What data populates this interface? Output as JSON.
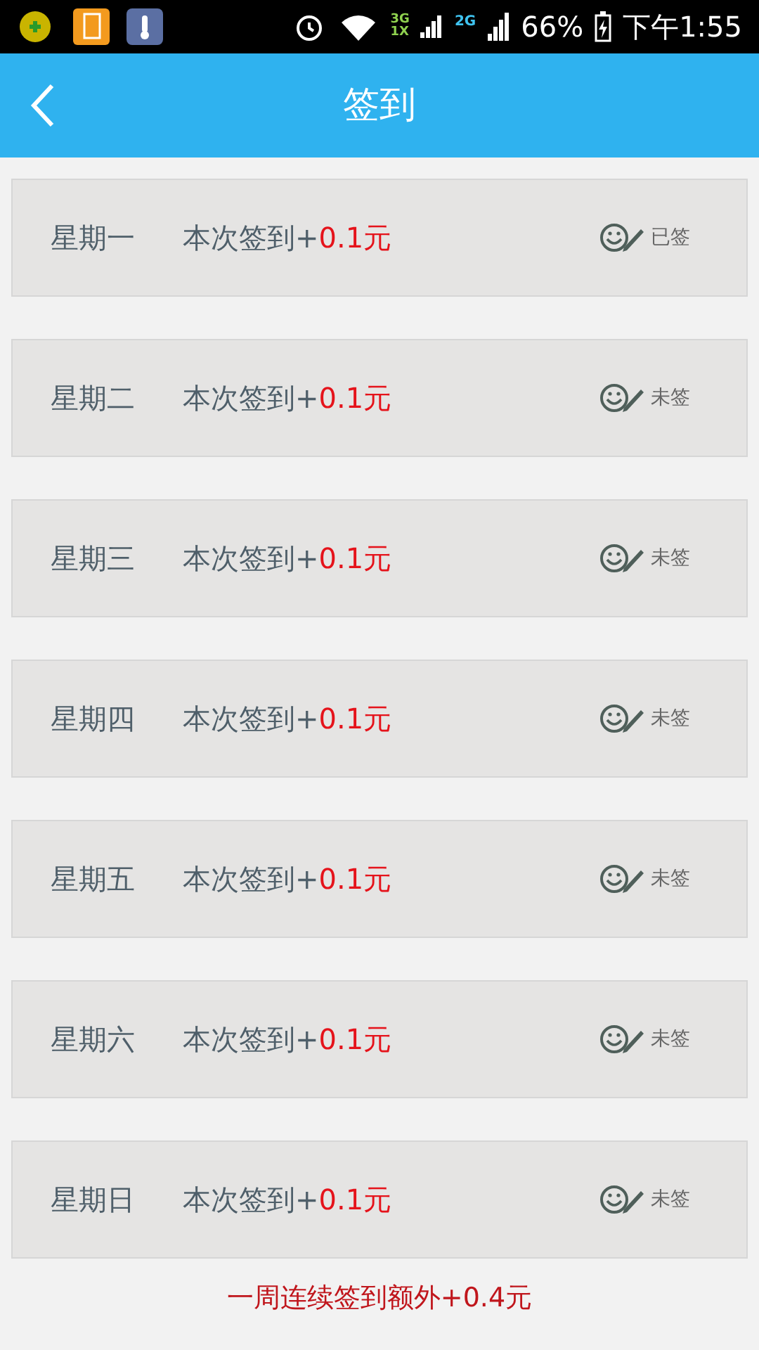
{
  "status_bar": {
    "network_3g": "3G",
    "network_1x": "1X",
    "network_2g": "2G",
    "battery": "66%",
    "time": "下午1:55"
  },
  "header": {
    "title": "签到"
  },
  "days": [
    {
      "day": "星期一",
      "reward_label": "本次签到+",
      "amount": "0.1元",
      "status": "已签"
    },
    {
      "day": "星期二",
      "reward_label": "本次签到+",
      "amount": "0.1元",
      "status": "未签"
    },
    {
      "day": "星期三",
      "reward_label": "本次签到+",
      "amount": "0.1元",
      "status": "未签"
    },
    {
      "day": "星期四",
      "reward_label": "本次签到+",
      "amount": "0.1元",
      "status": "未签"
    },
    {
      "day": "星期五",
      "reward_label": "本次签到+",
      "amount": "0.1元",
      "status": "未签"
    },
    {
      "day": "星期六",
      "reward_label": "本次签到+",
      "amount": "0.1元",
      "status": "未签"
    },
    {
      "day": "星期日",
      "reward_label": "本次签到+",
      "amount": "0.1元",
      "status": "未签"
    }
  ],
  "footer_note": "一周连续签到额外+0.4元"
}
